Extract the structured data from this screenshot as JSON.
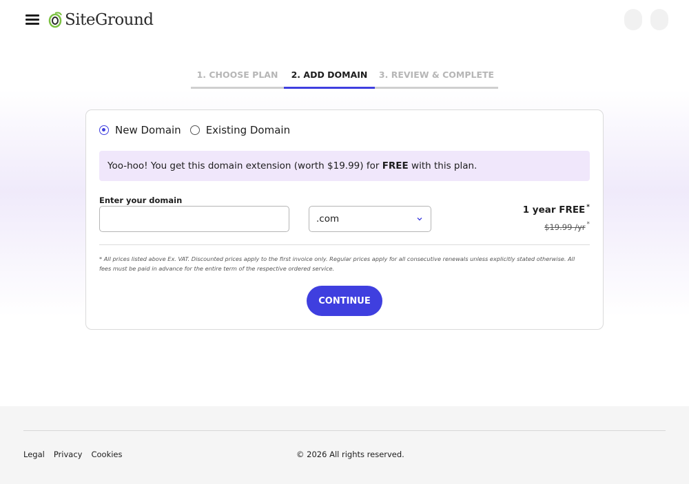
{
  "brand": {
    "name": "SiteGround",
    "accent_color": "#3f3fdf",
    "logo_icon": "siteground-swirl-icon"
  },
  "header": {
    "menu_icon": "hamburger-menu-icon"
  },
  "steps": [
    {
      "label": "1. Choose Plan",
      "state": "done"
    },
    {
      "label": "2. Add Domain",
      "state": "active"
    },
    {
      "label": "3. Review & Complete",
      "state": "pending"
    }
  ],
  "domain_type": {
    "selected": "new",
    "options": [
      {
        "label": "New Domain"
      },
      {
        "label": "Existing Domain"
      }
    ]
  },
  "promo": {
    "text_before": "Yoo-hoo! You get this domain extension (worth $19.99) for ",
    "bold": "FREE",
    "text_after": " with this plan."
  },
  "domain_form": {
    "label": "Enter your domain",
    "input_value": "",
    "input_placeholder": "",
    "tld_selected": ".com"
  },
  "pricing": {
    "main": "1 year FREE",
    "main_asterisk": "*",
    "regular": "$19.99",
    "regular_suffix": " /yr",
    "regular_asterisk": "*"
  },
  "disclaimer": "* All prices listed above Ex. VAT. Discounted prices apply to the first invoice only. Regular prices apply for all consecutive renewals unless explicitly stated otherwise. All fees must be paid in advance for the entire term of the respective ordered service.",
  "continue_label": "Continue",
  "footer": {
    "links": [
      {
        "label": "Legal"
      },
      {
        "label": "Privacy"
      },
      {
        "label": "Cookies"
      }
    ],
    "copyright": "© 2026 All rights reserved."
  }
}
